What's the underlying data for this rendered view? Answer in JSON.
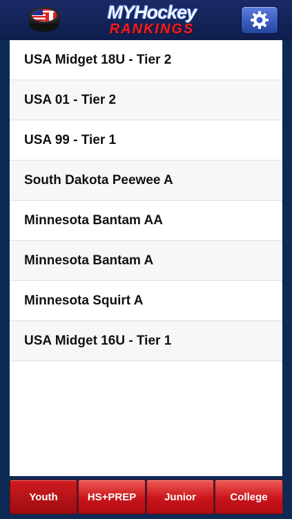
{
  "header": {
    "logo_top": "MYHockey",
    "logo_bottom": "RANKINGS",
    "settings_icon": "gear-icon"
  },
  "list": {
    "items": [
      "USA Midget 18U - Tier 2",
      "USA 01 - Tier 2",
      "USA 99 - Tier 1",
      "South Dakota Peewee A",
      "Minnesota Bantam AA",
      "Minnesota Bantam A",
      "Minnesota Squirt A",
      "USA Midget 16U - Tier 1"
    ]
  },
  "tabs": [
    {
      "label": "Youth",
      "active": true
    },
    {
      "label": "HS+PREP",
      "active": false
    },
    {
      "label": "Junior",
      "active": false
    },
    {
      "label": "College",
      "active": false
    }
  ],
  "colors": {
    "background": "#0d2a55",
    "tab_red": "#c8141a",
    "brand_red": "#e8202a"
  }
}
